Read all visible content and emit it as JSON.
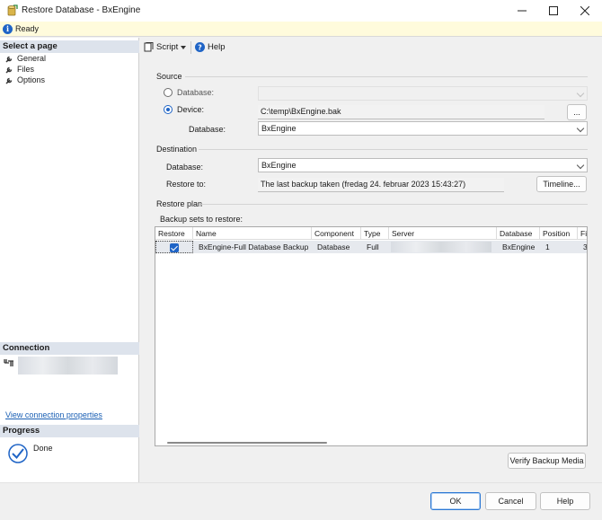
{
  "window": {
    "title": "Restore Database - BxEngine"
  },
  "status": {
    "text": "Ready"
  },
  "left_pane": {
    "select_page_header": "Select a page",
    "pages": [
      {
        "label": "General"
      },
      {
        "label": "Files"
      },
      {
        "label": "Options"
      }
    ],
    "connection_header": "Connection",
    "view_connection_link": "View connection properties",
    "progress_header": "Progress",
    "progress_text": "Done"
  },
  "toolbar": {
    "script_label": "Script",
    "help_label": "Help"
  },
  "source": {
    "group_label": "Source",
    "database_radio_label": "Database:",
    "device_radio_label": "Device:",
    "device_value": "C:\\temp\\BxEngine.bak",
    "browse_label": "...",
    "database_label": "Database:",
    "database_value": "BxEngine",
    "selected_option": "Device"
  },
  "destination": {
    "group_label": "Destination",
    "database_label": "Database:",
    "database_value": "BxEngine",
    "restore_to_label": "Restore to:",
    "restore_to_value": "The last backup taken (fredag 24. februar 2023 15:43:27)",
    "timeline_label": "Timeline..."
  },
  "restore_plan": {
    "group_label": "Restore plan",
    "backup_sets_label": "Backup sets to restore:",
    "columns": [
      "Restore",
      "Name",
      "Component",
      "Type",
      "Server",
      "Database",
      "Position",
      "Fi"
    ],
    "rows": [
      {
        "restore": true,
        "name": "BxEngine-Full Database Backup",
        "component": "Database",
        "type": "Full",
        "server": "",
        "database": "BxEngine",
        "position": "1",
        "first": "3"
      }
    ],
    "verify_label": "Verify Backup Media"
  },
  "footer": {
    "ok_label": "OK",
    "cancel_label": "Cancel",
    "help_label": "Help"
  },
  "colors": {
    "accent": "#1f64c6",
    "status_bar": "#fffbdc",
    "section_header": "#dde3ec"
  }
}
